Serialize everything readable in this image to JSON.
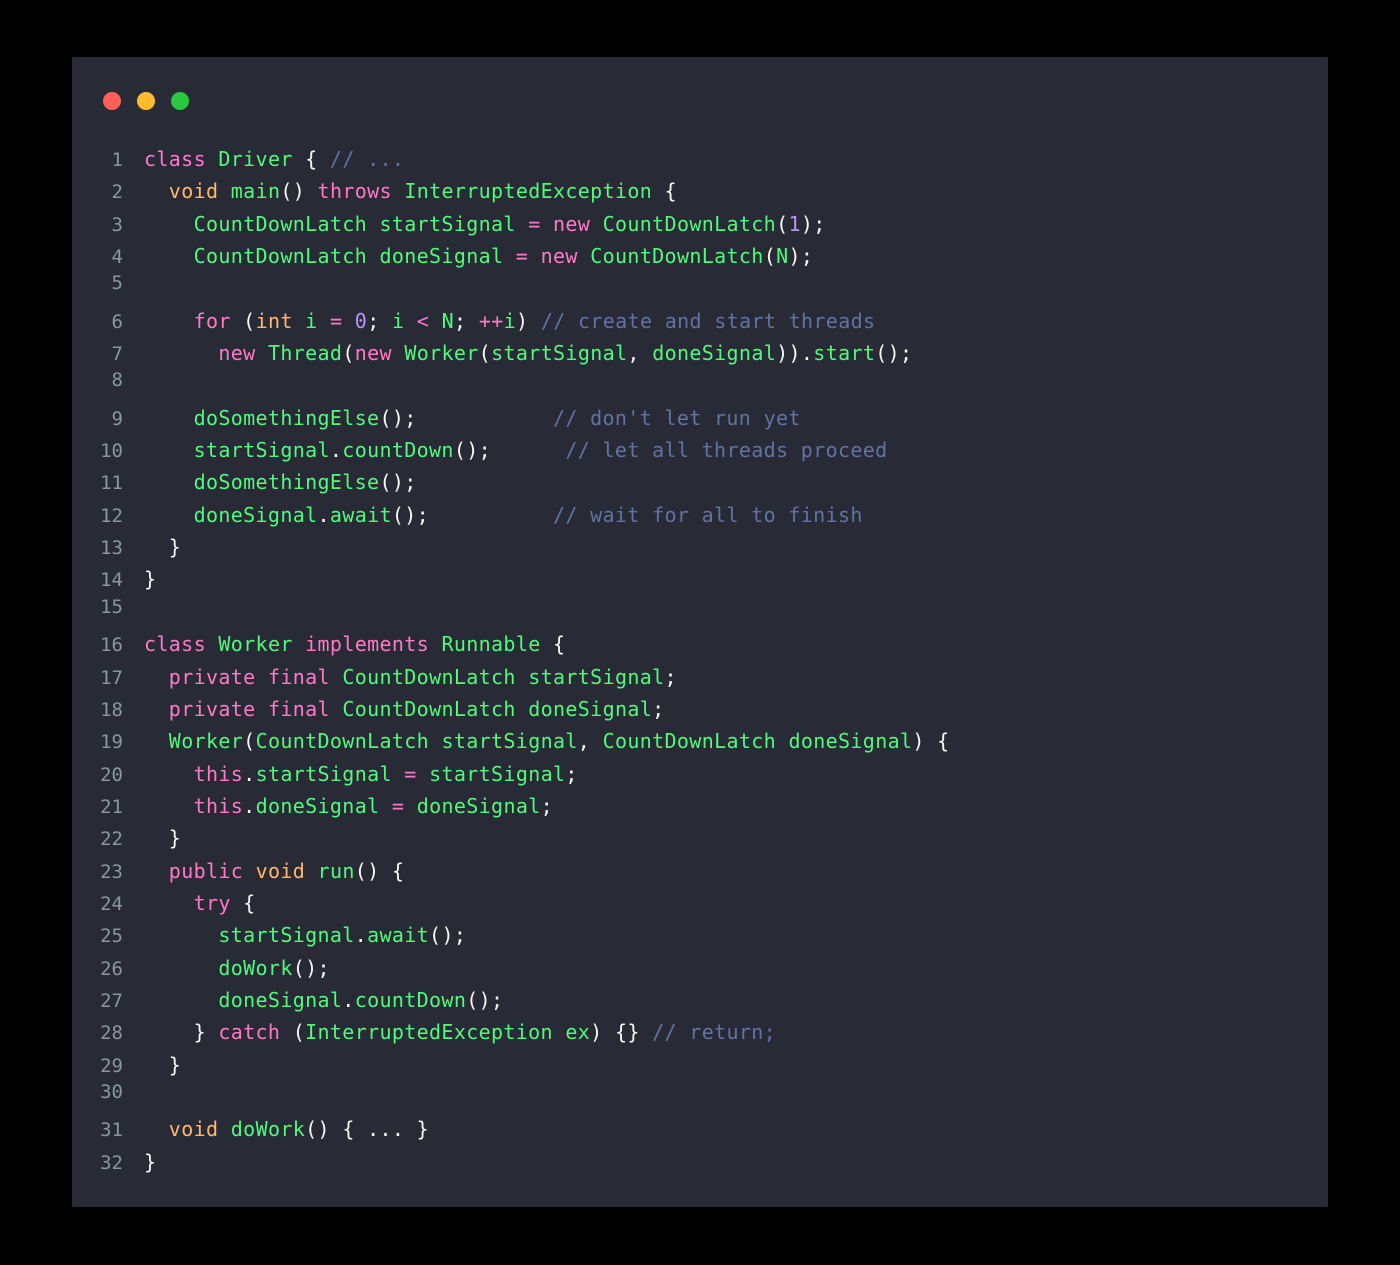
{
  "window": {
    "title": "code-snippet-window",
    "controls": [
      {
        "name": "close",
        "color": "#ff5f56"
      },
      {
        "name": "minimize",
        "color": "#ffbd2e"
      },
      {
        "name": "maximize",
        "color": "#28c840"
      }
    ]
  },
  "theme": {
    "page_background": "#000000",
    "card_background": "#282a36",
    "default_text": "#f8f8f2",
    "line_number": "#8b96a0",
    "keyword": "#ff79c6",
    "type": "#ffb86c",
    "identifier": "#50fa7b",
    "number": "#bd93f9",
    "comment": "#6272a4"
  },
  "code": {
    "language": "java",
    "line_count": 32,
    "lines": [
      {
        "n": "1",
        "tokens": [
          {
            "t": "key",
            "v": "class"
          },
          {
            "t": "punc",
            "v": " "
          },
          {
            "t": "ident",
            "v": "Driver"
          },
          {
            "t": "punc",
            "v": " { "
          },
          {
            "t": "comment",
            "v": "// ..."
          }
        ]
      },
      {
        "n": "2",
        "tokens": [
          {
            "t": "punc",
            "v": "  "
          },
          {
            "t": "type",
            "v": "void"
          },
          {
            "t": "punc",
            "v": " "
          },
          {
            "t": "ident",
            "v": "main"
          },
          {
            "t": "punc",
            "v": "() "
          },
          {
            "t": "key",
            "v": "throws"
          },
          {
            "t": "punc",
            "v": " "
          },
          {
            "t": "ident",
            "v": "InterruptedException"
          },
          {
            "t": "punc",
            "v": " {"
          }
        ]
      },
      {
        "n": "3",
        "tokens": [
          {
            "t": "punc",
            "v": "    "
          },
          {
            "t": "ident",
            "v": "CountDownLatch"
          },
          {
            "t": "punc",
            "v": " "
          },
          {
            "t": "ident",
            "v": "startSignal"
          },
          {
            "t": "punc",
            "v": " "
          },
          {
            "t": "op",
            "v": "="
          },
          {
            "t": "punc",
            "v": " "
          },
          {
            "t": "key",
            "v": "new"
          },
          {
            "t": "punc",
            "v": " "
          },
          {
            "t": "ident",
            "v": "CountDownLatch"
          },
          {
            "t": "punc",
            "v": "("
          },
          {
            "t": "num",
            "v": "1"
          },
          {
            "t": "punc",
            "v": ");"
          }
        ]
      },
      {
        "n": "4",
        "tokens": [
          {
            "t": "punc",
            "v": "    "
          },
          {
            "t": "ident",
            "v": "CountDownLatch"
          },
          {
            "t": "punc",
            "v": " "
          },
          {
            "t": "ident",
            "v": "doneSignal"
          },
          {
            "t": "punc",
            "v": " "
          },
          {
            "t": "op",
            "v": "="
          },
          {
            "t": "punc",
            "v": " "
          },
          {
            "t": "key",
            "v": "new"
          },
          {
            "t": "punc",
            "v": " "
          },
          {
            "t": "ident",
            "v": "CountDownLatch"
          },
          {
            "t": "punc",
            "v": "("
          },
          {
            "t": "ident",
            "v": "N"
          },
          {
            "t": "punc",
            "v": ");"
          }
        ]
      },
      {
        "n": "5",
        "tokens": []
      },
      {
        "n": "6",
        "tokens": [
          {
            "t": "punc",
            "v": "    "
          },
          {
            "t": "key",
            "v": "for"
          },
          {
            "t": "punc",
            "v": " ("
          },
          {
            "t": "type",
            "v": "int"
          },
          {
            "t": "punc",
            "v": " "
          },
          {
            "t": "ident",
            "v": "i"
          },
          {
            "t": "punc",
            "v": " "
          },
          {
            "t": "op",
            "v": "="
          },
          {
            "t": "punc",
            "v": " "
          },
          {
            "t": "num",
            "v": "0"
          },
          {
            "t": "punc",
            "v": "; "
          },
          {
            "t": "ident",
            "v": "i"
          },
          {
            "t": "punc",
            "v": " "
          },
          {
            "t": "op",
            "v": "<"
          },
          {
            "t": "punc",
            "v": " "
          },
          {
            "t": "ident",
            "v": "N"
          },
          {
            "t": "punc",
            "v": "; "
          },
          {
            "t": "op",
            "v": "++"
          },
          {
            "t": "ident",
            "v": "i"
          },
          {
            "t": "punc",
            "v": ") "
          },
          {
            "t": "comment",
            "v": "// create and start threads"
          }
        ]
      },
      {
        "n": "7",
        "tokens": [
          {
            "t": "punc",
            "v": "      "
          },
          {
            "t": "key",
            "v": "new"
          },
          {
            "t": "punc",
            "v": " "
          },
          {
            "t": "ident",
            "v": "Thread"
          },
          {
            "t": "punc",
            "v": "("
          },
          {
            "t": "key",
            "v": "new"
          },
          {
            "t": "punc",
            "v": " "
          },
          {
            "t": "ident",
            "v": "Worker"
          },
          {
            "t": "punc",
            "v": "("
          },
          {
            "t": "ident",
            "v": "startSignal"
          },
          {
            "t": "punc",
            "v": ", "
          },
          {
            "t": "ident",
            "v": "doneSignal"
          },
          {
            "t": "punc",
            "v": "))."
          },
          {
            "t": "ident",
            "v": "start"
          },
          {
            "t": "punc",
            "v": "();"
          }
        ]
      },
      {
        "n": "8",
        "tokens": []
      },
      {
        "n": "9",
        "tokens": [
          {
            "t": "punc",
            "v": "    "
          },
          {
            "t": "ident",
            "v": "doSomethingElse"
          },
          {
            "t": "punc",
            "v": "();           "
          },
          {
            "t": "comment",
            "v": "// don't let run yet"
          }
        ]
      },
      {
        "n": "10",
        "tokens": [
          {
            "t": "punc",
            "v": "    "
          },
          {
            "t": "ident",
            "v": "startSignal"
          },
          {
            "t": "punc",
            "v": "."
          },
          {
            "t": "ident",
            "v": "countDown"
          },
          {
            "t": "punc",
            "v": "();      "
          },
          {
            "t": "comment",
            "v": "// let all threads proceed"
          }
        ]
      },
      {
        "n": "11",
        "tokens": [
          {
            "t": "punc",
            "v": "    "
          },
          {
            "t": "ident",
            "v": "doSomethingElse"
          },
          {
            "t": "punc",
            "v": "();"
          }
        ]
      },
      {
        "n": "12",
        "tokens": [
          {
            "t": "punc",
            "v": "    "
          },
          {
            "t": "ident",
            "v": "doneSignal"
          },
          {
            "t": "punc",
            "v": "."
          },
          {
            "t": "ident",
            "v": "await"
          },
          {
            "t": "punc",
            "v": "();          "
          },
          {
            "t": "comment",
            "v": "// wait for all to finish"
          }
        ]
      },
      {
        "n": "13",
        "tokens": [
          {
            "t": "punc",
            "v": "  }"
          }
        ]
      },
      {
        "n": "14",
        "tokens": [
          {
            "t": "punc",
            "v": "}"
          }
        ]
      },
      {
        "n": "15",
        "tokens": []
      },
      {
        "n": "16",
        "tokens": [
          {
            "t": "key",
            "v": "class"
          },
          {
            "t": "punc",
            "v": " "
          },
          {
            "t": "ident",
            "v": "Worker"
          },
          {
            "t": "punc",
            "v": " "
          },
          {
            "t": "key",
            "v": "implements"
          },
          {
            "t": "punc",
            "v": " "
          },
          {
            "t": "ident",
            "v": "Runnable"
          },
          {
            "t": "punc",
            "v": " {"
          }
        ]
      },
      {
        "n": "17",
        "tokens": [
          {
            "t": "punc",
            "v": "  "
          },
          {
            "t": "key",
            "v": "private"
          },
          {
            "t": "punc",
            "v": " "
          },
          {
            "t": "key",
            "v": "final"
          },
          {
            "t": "punc",
            "v": " "
          },
          {
            "t": "ident",
            "v": "CountDownLatch"
          },
          {
            "t": "punc",
            "v": " "
          },
          {
            "t": "ident",
            "v": "startSignal"
          },
          {
            "t": "punc",
            "v": ";"
          }
        ]
      },
      {
        "n": "18",
        "tokens": [
          {
            "t": "punc",
            "v": "  "
          },
          {
            "t": "key",
            "v": "private"
          },
          {
            "t": "punc",
            "v": " "
          },
          {
            "t": "key",
            "v": "final"
          },
          {
            "t": "punc",
            "v": " "
          },
          {
            "t": "ident",
            "v": "CountDownLatch"
          },
          {
            "t": "punc",
            "v": " "
          },
          {
            "t": "ident",
            "v": "doneSignal"
          },
          {
            "t": "punc",
            "v": ";"
          }
        ]
      },
      {
        "n": "19",
        "tokens": [
          {
            "t": "punc",
            "v": "  "
          },
          {
            "t": "ident",
            "v": "Worker"
          },
          {
            "t": "punc",
            "v": "("
          },
          {
            "t": "ident",
            "v": "CountDownLatch"
          },
          {
            "t": "punc",
            "v": " "
          },
          {
            "t": "ident",
            "v": "startSignal"
          },
          {
            "t": "punc",
            "v": ", "
          },
          {
            "t": "ident",
            "v": "CountDownLatch"
          },
          {
            "t": "punc",
            "v": " "
          },
          {
            "t": "ident",
            "v": "doneSignal"
          },
          {
            "t": "punc",
            "v": ") {"
          }
        ]
      },
      {
        "n": "20",
        "tokens": [
          {
            "t": "punc",
            "v": "    "
          },
          {
            "t": "key",
            "v": "this"
          },
          {
            "t": "punc",
            "v": "."
          },
          {
            "t": "ident",
            "v": "startSignal"
          },
          {
            "t": "punc",
            "v": " "
          },
          {
            "t": "op",
            "v": "="
          },
          {
            "t": "punc",
            "v": " "
          },
          {
            "t": "ident",
            "v": "startSignal"
          },
          {
            "t": "punc",
            "v": ";"
          }
        ]
      },
      {
        "n": "21",
        "tokens": [
          {
            "t": "punc",
            "v": "    "
          },
          {
            "t": "key",
            "v": "this"
          },
          {
            "t": "punc",
            "v": "."
          },
          {
            "t": "ident",
            "v": "doneSignal"
          },
          {
            "t": "punc",
            "v": " "
          },
          {
            "t": "op",
            "v": "="
          },
          {
            "t": "punc",
            "v": " "
          },
          {
            "t": "ident",
            "v": "doneSignal"
          },
          {
            "t": "punc",
            "v": ";"
          }
        ]
      },
      {
        "n": "22",
        "tokens": [
          {
            "t": "punc",
            "v": "  }"
          }
        ]
      },
      {
        "n": "23",
        "tokens": [
          {
            "t": "punc",
            "v": "  "
          },
          {
            "t": "key",
            "v": "public"
          },
          {
            "t": "punc",
            "v": " "
          },
          {
            "t": "type",
            "v": "void"
          },
          {
            "t": "punc",
            "v": " "
          },
          {
            "t": "ident",
            "v": "run"
          },
          {
            "t": "punc",
            "v": "() {"
          }
        ]
      },
      {
        "n": "24",
        "tokens": [
          {
            "t": "punc",
            "v": "    "
          },
          {
            "t": "key",
            "v": "try"
          },
          {
            "t": "punc",
            "v": " {"
          }
        ]
      },
      {
        "n": "25",
        "tokens": [
          {
            "t": "punc",
            "v": "      "
          },
          {
            "t": "ident",
            "v": "startSignal"
          },
          {
            "t": "punc",
            "v": "."
          },
          {
            "t": "ident",
            "v": "await"
          },
          {
            "t": "punc",
            "v": "();"
          }
        ]
      },
      {
        "n": "26",
        "tokens": [
          {
            "t": "punc",
            "v": "      "
          },
          {
            "t": "ident",
            "v": "doWork"
          },
          {
            "t": "punc",
            "v": "();"
          }
        ]
      },
      {
        "n": "27",
        "tokens": [
          {
            "t": "punc",
            "v": "      "
          },
          {
            "t": "ident",
            "v": "doneSignal"
          },
          {
            "t": "punc",
            "v": "."
          },
          {
            "t": "ident",
            "v": "countDown"
          },
          {
            "t": "punc",
            "v": "();"
          }
        ]
      },
      {
        "n": "28",
        "tokens": [
          {
            "t": "punc",
            "v": "    } "
          },
          {
            "t": "key",
            "v": "catch"
          },
          {
            "t": "punc",
            "v": " ("
          },
          {
            "t": "ident",
            "v": "InterruptedException"
          },
          {
            "t": "punc",
            "v": " "
          },
          {
            "t": "ident",
            "v": "ex"
          },
          {
            "t": "punc",
            "v": ") {} "
          },
          {
            "t": "comment",
            "v": "// return;"
          }
        ]
      },
      {
        "n": "29",
        "tokens": [
          {
            "t": "punc",
            "v": "  }"
          }
        ]
      },
      {
        "n": "30",
        "tokens": []
      },
      {
        "n": "31",
        "tokens": [
          {
            "t": "punc",
            "v": "  "
          },
          {
            "t": "type",
            "v": "void"
          },
          {
            "t": "punc",
            "v": " "
          },
          {
            "t": "ident",
            "v": "doWork"
          },
          {
            "t": "punc",
            "v": "() { ... }"
          }
        ]
      },
      {
        "n": "32",
        "tokens": [
          {
            "t": "punc",
            "v": "}"
          }
        ]
      }
    ]
  }
}
